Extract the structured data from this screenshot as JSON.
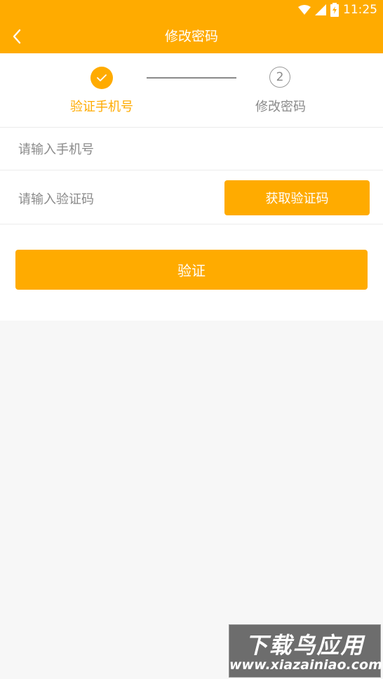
{
  "statusbar": {
    "time": "11:25",
    "icons": [
      "wifi-icon",
      "cellular-signal-icon",
      "battery-charging-icon"
    ]
  },
  "appbar": {
    "back_icon": "chevron-left-icon",
    "title": "修改密码"
  },
  "steps": [
    {
      "label": "验证手机号",
      "state": "done",
      "icon": "check-icon"
    },
    {
      "label": "修改密码",
      "number": "2",
      "state": "pending"
    }
  ],
  "form": {
    "phone_placeholder": "请输入手机号",
    "phone_value": "",
    "code_placeholder": "请输入验证码",
    "code_value": "",
    "get_code_label": "获取验证码",
    "verify_label": "验证"
  },
  "watermark": {
    "title": "下载鸟应用",
    "url": "www.xiazainiao.com"
  },
  "colors": {
    "accent": "#ffab00",
    "background": "#f7f7f7",
    "muted_text": "#8a8a8a"
  }
}
